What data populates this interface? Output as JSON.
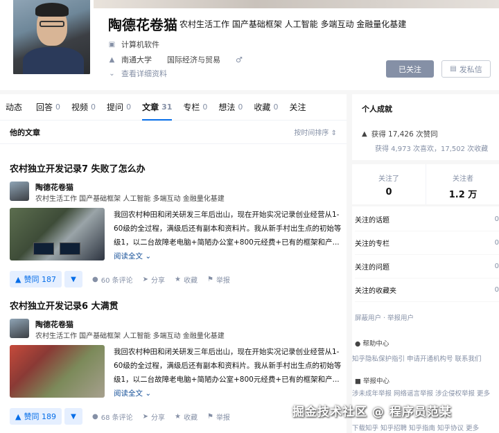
{
  "profile": {
    "name": "陶德花卷猫",
    "headline": "农村生活工作 国产基础框架 人工智能 多端互动 金融量化基建",
    "industry": "计算机软件",
    "school": "南通大学",
    "major": "国际经济与贸易",
    "gender_symbol": "♂",
    "more_info": "查看详细资料",
    "followed_button": "已关注",
    "message_button": "发私信"
  },
  "tabs": [
    {
      "label": "动态",
      "count": ""
    },
    {
      "label": "回答",
      "count": "0"
    },
    {
      "label": "视频",
      "count": "0"
    },
    {
      "label": "提问",
      "count": "0"
    },
    {
      "label": "文章",
      "count": "31"
    },
    {
      "label": "专栏",
      "count": "0"
    },
    {
      "label": "想法",
      "count": "0"
    },
    {
      "label": "收藏",
      "count": "0"
    },
    {
      "label": "关注",
      "count": ""
    }
  ],
  "section": {
    "title": "他的文章",
    "sort": "按时间排序"
  },
  "articles": [
    {
      "title": "农村独立开发记录7 失败了怎么办",
      "author": "陶德花卷猫",
      "headline": "农村生活工作 国产基础框架 人工智能 多端互动 金融量化基建",
      "excerpt": "我回农村种田和闭关研发三年后出山，现在开始实况记录创业经营从1-60级的全过程，满级后还有副本和资料片。我从新手村出生点的初始等级1，以二台故障老电脑+简陋办公室+800元经费+已有的框架和产...",
      "read_more": "阅读全文",
      "vote": "赞同 187",
      "comments": "60 条评论",
      "share": "分享",
      "collect": "收藏",
      "report": "举报"
    },
    {
      "title": "农村独立开发记录6 大满贯",
      "author": "陶德花卷猫",
      "headline": "农村生活工作 国产基础框架 人工智能 多端互动 金融量化基建",
      "excerpt": "我回农村种田和闭关研发三年后出山，现在开始实况记录创业经营从1-60级的全过程，满级后还有副本和资料片。我从新手村出生点的初始等级1，以二台故障老电脑+简陋办公室+800元经费+已有的框架和产...",
      "read_more": "阅读全文",
      "vote": "赞同 189",
      "comments": "68 条评论",
      "share": "分享",
      "collect": "收藏",
      "report": "举报"
    }
  ],
  "achievements": {
    "title": "个人成就",
    "upvotes": "获得 17,426 次赞同",
    "likes_collections": "获得 4,973 次喜欢，17,502 次收藏"
  },
  "follow": {
    "following_label": "关注了",
    "following_value": "0",
    "followers_label": "关注者",
    "followers_value": "1.2 万"
  },
  "side_lists": [
    {
      "label": "关注的话题",
      "value": "0"
    },
    {
      "label": "关注的专栏",
      "value": "0"
    },
    {
      "label": "关注的问题",
      "value": "0"
    },
    {
      "label": "关注的收藏夹",
      "value": "0"
    }
  ],
  "side_links": {
    "blocked": "屏蔽用户 · 举报用户",
    "help_title": "帮助中心",
    "help_links": "知乎隐私保护指引   申请开通机构号   联系我们",
    "report_title": "举报中心",
    "report_links": "涉未成年举报   网络谣言举报   涉企侵权举报   更多",
    "about_links": "下载知乎   知乎招聘   知乎指南   知乎协议   更多"
  },
  "watermark": "掘金技术社区 @ 程序员范某"
}
